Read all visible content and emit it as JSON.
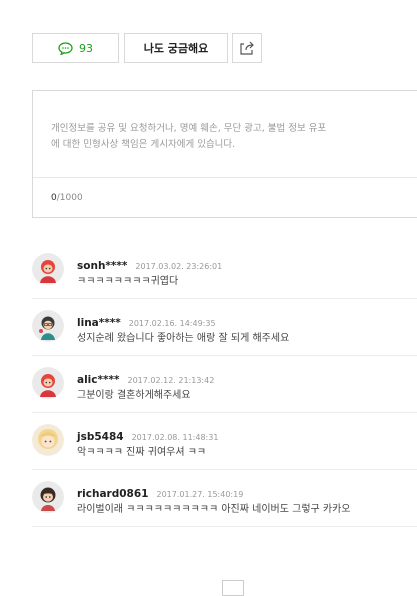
{
  "actions": {
    "comment_count": "93",
    "curious_label": "나도 궁금해요"
  },
  "editor": {
    "placeholder_line1": "개인정보를 공유 및 요청하거나, 명예 훼손, 무단 광고, 불법 정보 유포",
    "placeholder_line2": "에 대한 민형사상 책임은 게시자에게 있습니다.",
    "char_count": "0",
    "char_limit": "/1000"
  },
  "comments": [
    {
      "author": "sonh****",
      "date": "2017.03.02. 23:26:01",
      "text": "ㅋㅋㅋㅋㅋㅋㅋㅋ귀엽다",
      "avatar": "red-character"
    },
    {
      "author": "lina****",
      "date": "2017.02.16. 14:49:35",
      "text": "성지순례 왔습니다 좋아하는 애랑 잘 되게 해주세요",
      "avatar": "teal-character"
    },
    {
      "author": "alic****",
      "date": "2017.02.12. 21:13:42",
      "text": "그분이랑 결혼하게해주세요",
      "avatar": "red-character"
    },
    {
      "author": "jsb5484",
      "date": "2017.02.08. 11:48:31",
      "text": "악ㅋㅋㅋㅋ 진짜 귀여우셔 ㅋㅋ",
      "avatar": "blonde-character"
    },
    {
      "author": "richard0861",
      "date": "2017.01.27. 15:40:19",
      "text": "라이벌이래 ㅋㅋㅋㅋㅋㅋㅋㅋㅋㅋ 아진짜 네이버도 그렇구 카카오",
      "avatar": "dark-hair-character"
    }
  ],
  "colors": {
    "comment_green": "#1aa21a",
    "border": "#d9d9d9"
  }
}
